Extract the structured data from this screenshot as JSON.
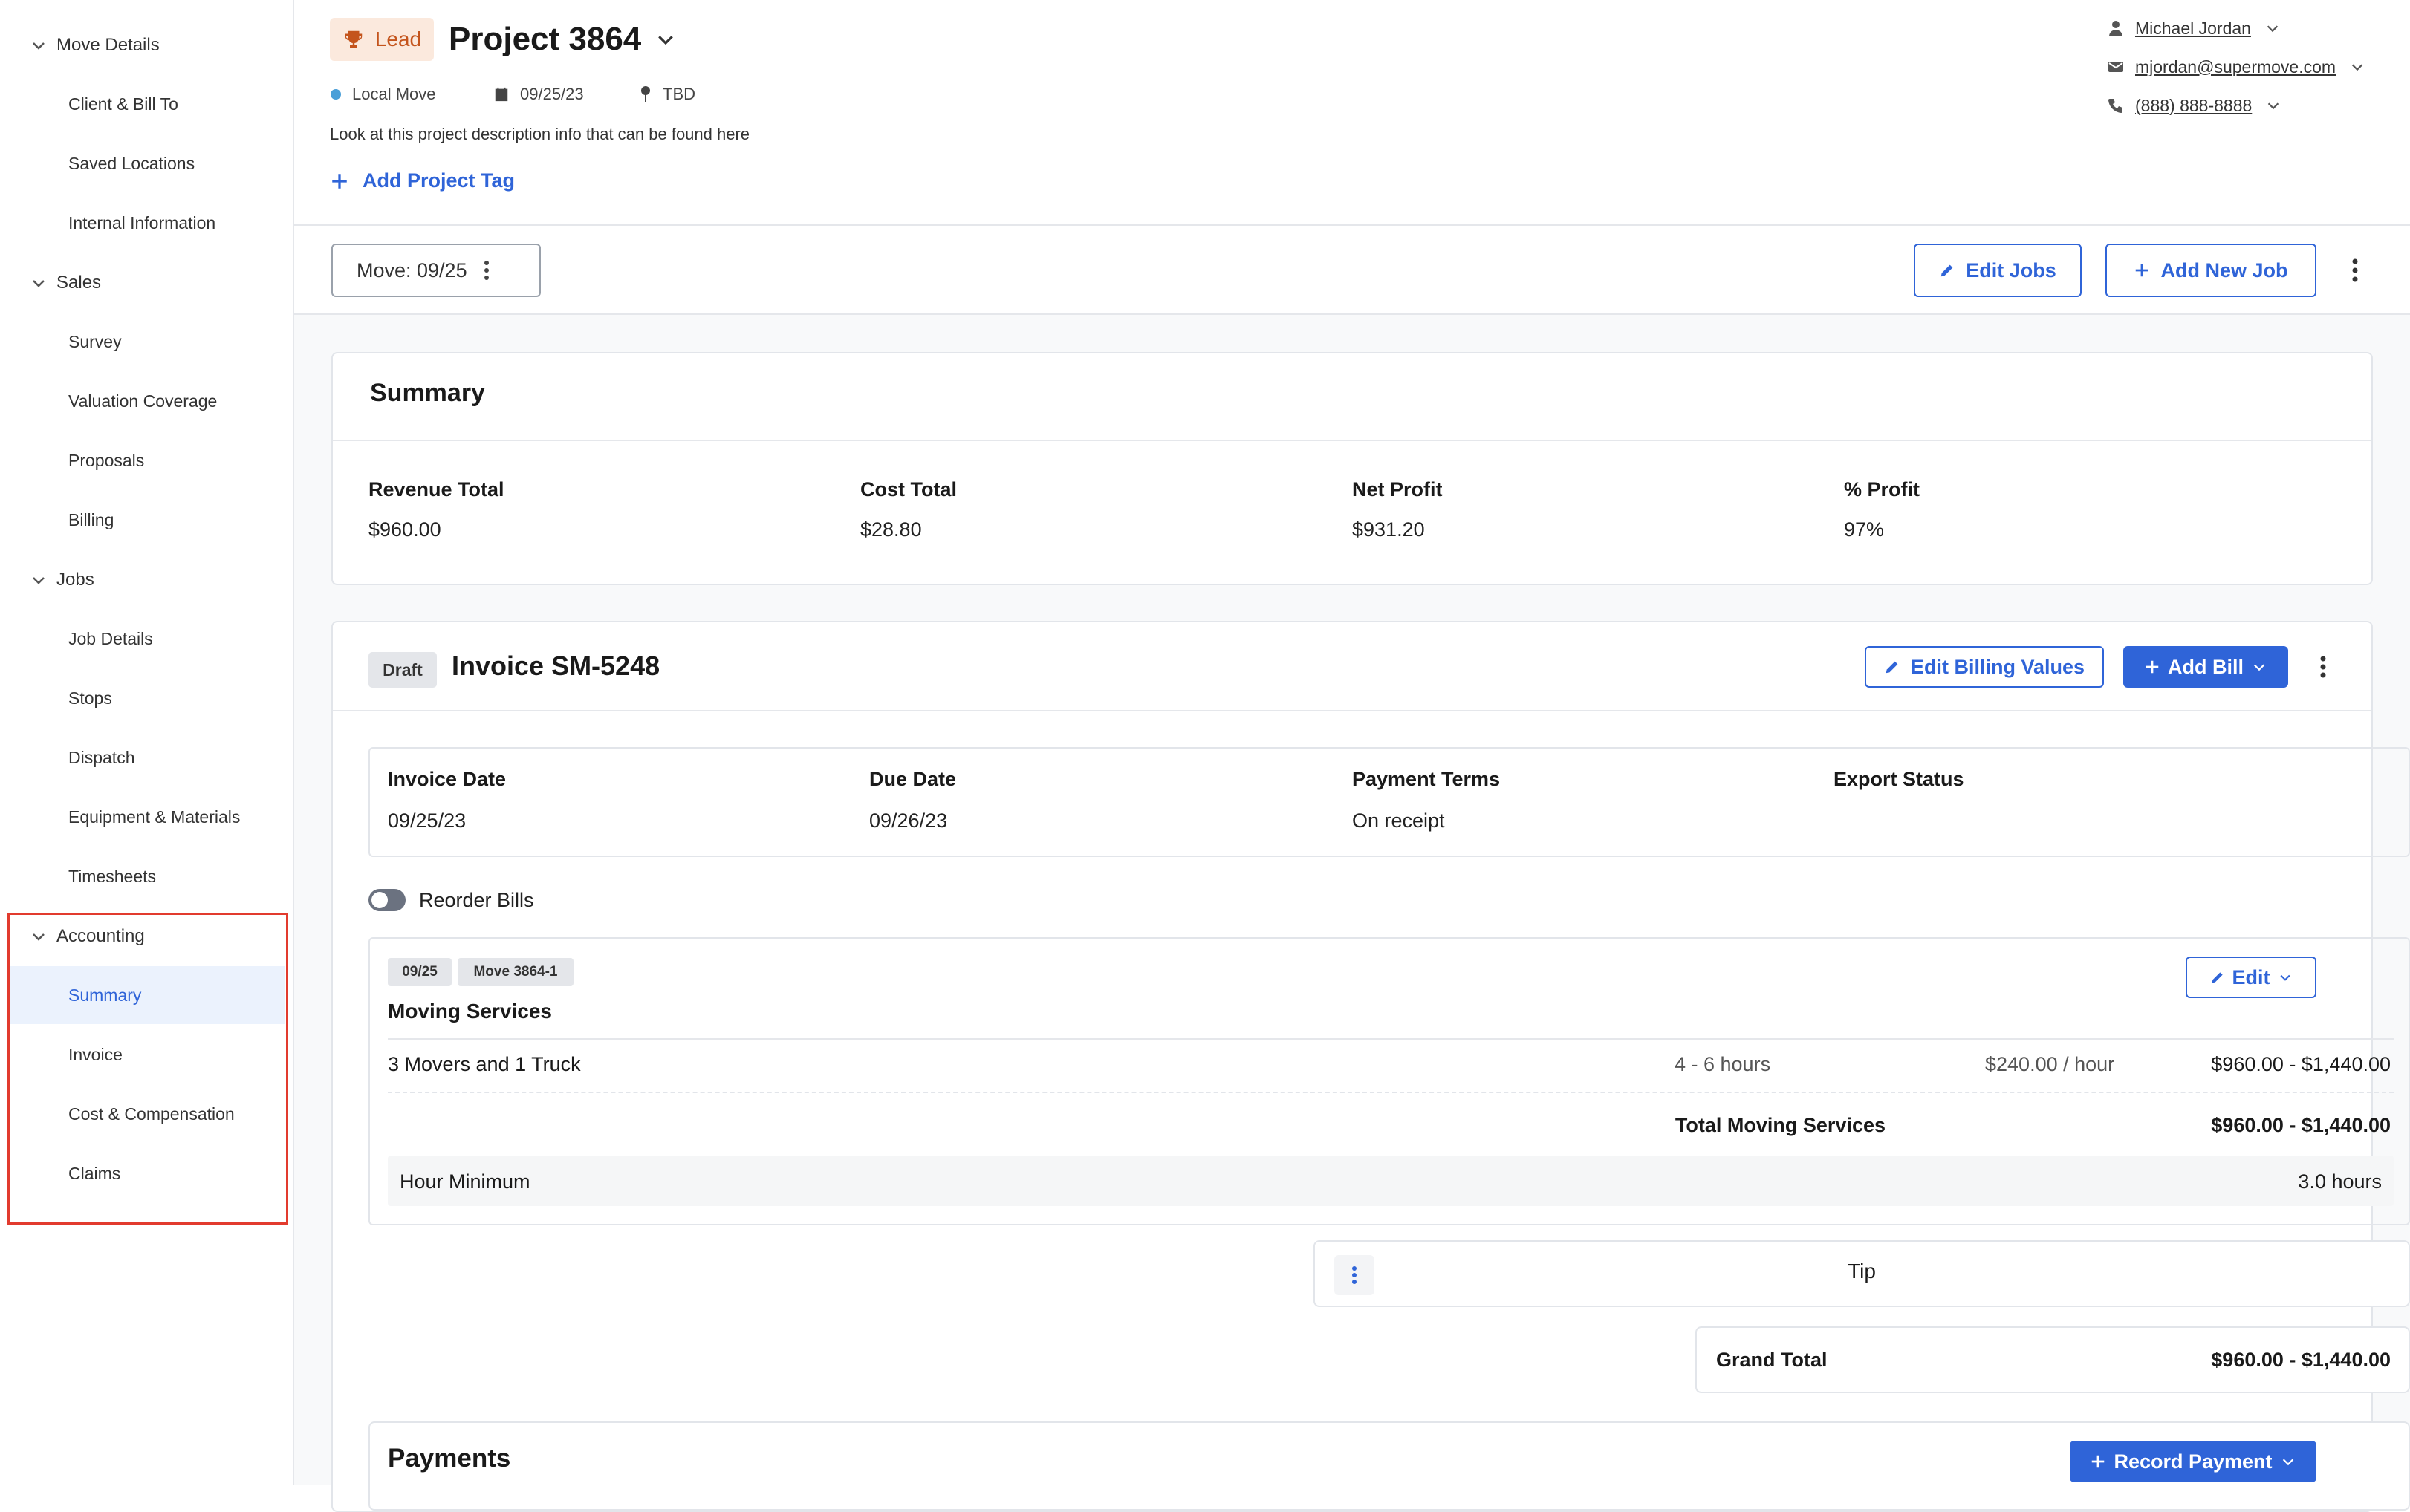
{
  "sidebar": {
    "groups": [
      {
        "label": "Move Details",
        "items": [
          "Client & Bill To",
          "Saved Locations",
          "Internal Information"
        ]
      },
      {
        "label": "Sales",
        "items": [
          "Survey",
          "Valuation Coverage",
          "Proposals",
          "Billing"
        ]
      },
      {
        "label": "Jobs",
        "items": [
          "Job Details",
          "Stops",
          "Dispatch",
          "Equipment & Materials",
          "Timesheets"
        ]
      },
      {
        "label": "Accounting",
        "items": [
          "Summary",
          "Invoice",
          "Cost & Compensation",
          "Claims"
        ]
      }
    ],
    "active_item": "Summary"
  },
  "header": {
    "status_badge": "Lead",
    "project_title": "Project 3864",
    "move_type": "Local Move",
    "move_date": "09/25/23",
    "location": "TBD",
    "description": "Look at this project description info that can be found here",
    "add_tag_label": "Add Project Tag",
    "contact": {
      "name": "Michael Jordan",
      "email": "mjordan@supermove.com",
      "phone": "(888) 888-8888"
    }
  },
  "jobbar": {
    "move_selector": "Move: 09/25",
    "edit_jobs_label": "Edit Jobs",
    "add_job_label": "Add New Job"
  },
  "summary": {
    "title": "Summary",
    "metrics": [
      {
        "label": "Revenue Total",
        "value": "$960.00"
      },
      {
        "label": "Cost Total",
        "value": "$28.80"
      },
      {
        "label": "Net Profit",
        "value": "$931.20"
      },
      {
        "label": "% Profit",
        "value": "97%"
      }
    ]
  },
  "invoice": {
    "status_badge": "Draft",
    "title": "Invoice SM-5248",
    "edit_billing_label": "Edit Billing Values",
    "add_bill_label": "Add Bill",
    "info": [
      {
        "label": "Invoice Date",
        "value": "09/25/23"
      },
      {
        "label": "Due Date",
        "value": "09/26/23"
      },
      {
        "label": "Payment Terms",
        "value": "On receipt"
      },
      {
        "label": "Export Status",
        "value": ""
      }
    ],
    "reorder_label": "Reorder Bills",
    "bill": {
      "tags": [
        "09/25",
        "Move 3864-1"
      ],
      "edit_label": "Edit",
      "name": "Moving Services",
      "line": {
        "description": "3 Movers and 1 Truck",
        "quantity": "4 - 6 hours",
        "rate": "$240.00 / hour",
        "amount": "$960.00 - $1,440.00"
      },
      "total_label": "Total Moving Services",
      "total_value": "$960.00 - $1,440.00",
      "minimum_label": "Hour Minimum",
      "minimum_value": "3.0 hours"
    },
    "tip_label": "Tip",
    "grand_total_label": "Grand Total",
    "grand_total_value": "$960.00 - $1,440.00"
  },
  "payments": {
    "title": "Payments",
    "record_payment_label": "Record Payment"
  },
  "colors": {
    "accent": "#2f64d8",
    "lead_badge_bg": "#fbe9dd",
    "lead_badge_text": "#c4541c",
    "highlight_border": "#e23b2e",
    "active_bg": "#ebf2fd"
  }
}
